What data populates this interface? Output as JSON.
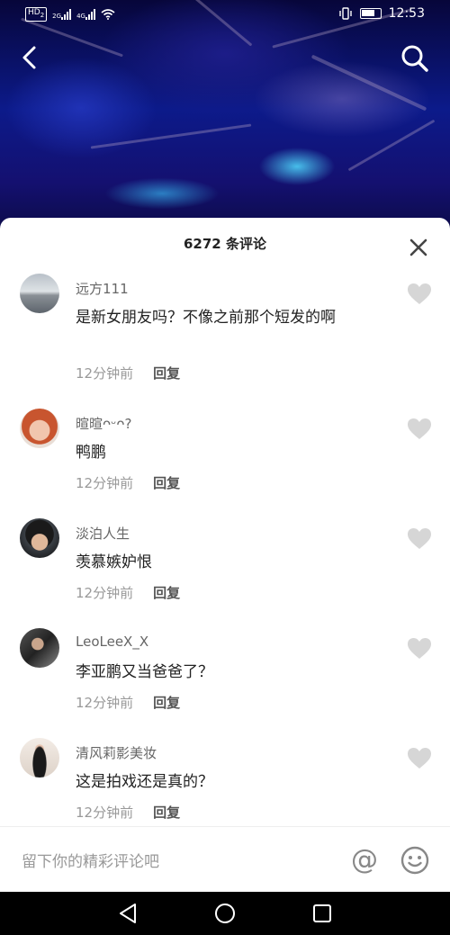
{
  "status_bar": {
    "hd_badge": "HD",
    "sim_slot": "2",
    "net1": "2G",
    "net2": "4G",
    "time": "12:53"
  },
  "comments_panel": {
    "title": "6272 条评论",
    "reply_label": "回复",
    "comments": [
      {
        "username": "远方111",
        "text": "是新女朋友吗？不像之前那个短发的啊",
        "time": "12分钟前"
      },
      {
        "username": "暄暄ᴖᵕᴖ?",
        "text": "鸭鹏",
        "time": "12分钟前"
      },
      {
        "username": "淡泊人生",
        "text": "羡慕嫉妒恨",
        "time": "12分钟前"
      },
      {
        "username": "LeoLeeX_X",
        "text": "李亚鹏又当爸爸了？",
        "time": "12分钟前"
      },
      {
        "username": "清风莉影美妆",
        "text": "这是拍戏还是真的？",
        "time": "12分钟前"
      }
    ]
  },
  "input_bar": {
    "placeholder": "留下你的精彩评论吧",
    "at_symbol": "@"
  },
  "icons": {
    "back": "chevron-left-icon",
    "search": "search-icon",
    "close": "close-icon",
    "like": "heart-icon",
    "emoji": "smiley-icon",
    "nav_back": "triangle-back-icon",
    "nav_home": "circle-home-icon",
    "nav_recent": "square-recent-icon"
  },
  "colors": {
    "panel_bg": "#ffffff",
    "heart": "#d6d6d6",
    "meta_text": "#999999"
  }
}
